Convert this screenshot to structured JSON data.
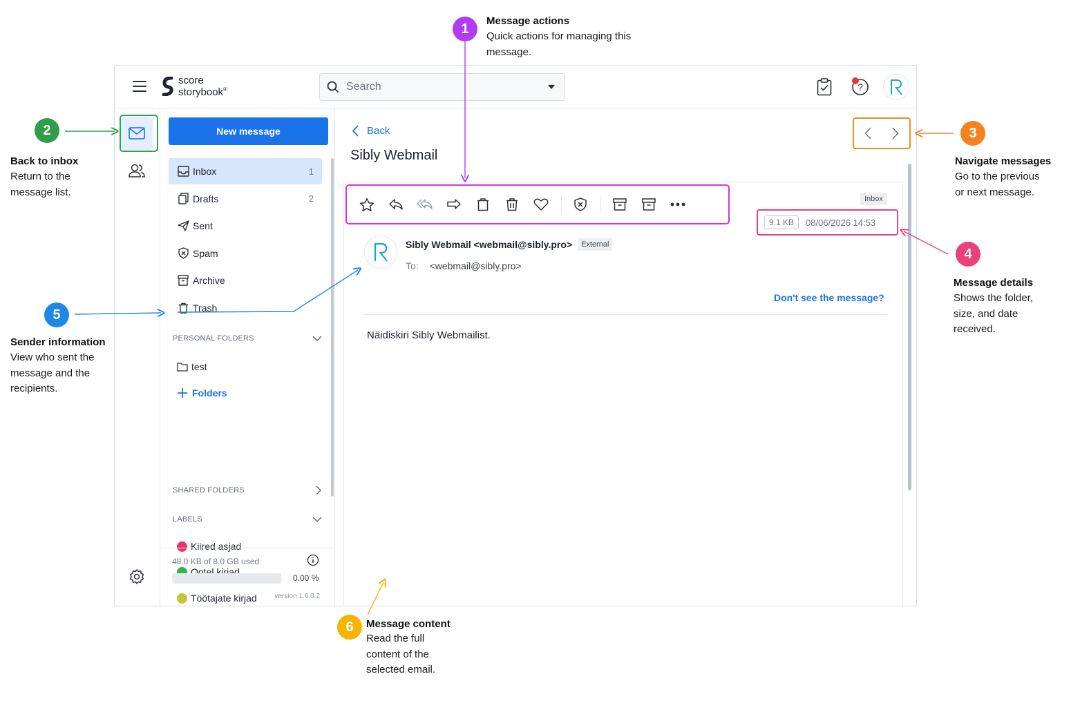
{
  "app": {
    "logo_line1": "score",
    "logo_line2": "storybook",
    "logo_mark": "®"
  },
  "search": {
    "placeholder": "Search"
  },
  "compose": {
    "label": "New message"
  },
  "folders": [
    {
      "name": "Inbox",
      "count": "1",
      "icon": "inbox-icon",
      "active": true
    },
    {
      "name": "Drafts",
      "count": "2",
      "icon": "drafts-icon",
      "active": false
    },
    {
      "name": "Sent",
      "count": "",
      "icon": "sent-icon",
      "active": false
    },
    {
      "name": "Spam",
      "count": "",
      "icon": "spam-icon",
      "active": false
    },
    {
      "name": "Archive",
      "count": "",
      "icon": "archive-icon",
      "active": false
    },
    {
      "name": "Trash",
      "count": "",
      "icon": "trash-icon",
      "active": false
    }
  ],
  "personal_folders": {
    "heading": "PERSONAL FOLDERS",
    "items": [
      "test"
    ],
    "add_label": "Folders"
  },
  "shared_folders": {
    "heading": "SHARED FOLDERS"
  },
  "labels": {
    "heading": "LABELS",
    "items": [
      {
        "name": "Kiired asjad",
        "color": "#e8336d"
      },
      {
        "name": "Ootel kirjad",
        "color": "#2fb550"
      },
      {
        "name": "Töötajate kirjad",
        "color": "#c8c43a"
      }
    ]
  },
  "storage": {
    "used_text": "48.0 KB of 8.0 GB used",
    "percent_text": "0.00 %",
    "percent": 0,
    "version": "version 1.6.0.2"
  },
  "message": {
    "back_label": "Back",
    "subject": "Sibly Webmail",
    "folder_tag": "Inbox",
    "size": "9.1 KB",
    "date": "08/06/2026 14:53",
    "sender": "Sibly Webmail <webmail@sibly.pro>",
    "sender_tag": "External",
    "to_label": "To:",
    "to": "<webmail@sibly.pro>",
    "dont_see": "Don't see the message?",
    "body": "Näidiskiri Sibly Webmailist."
  },
  "annotations": [
    {
      "num": "1",
      "title": "Message actions",
      "desc": [
        "Quick actions for managing this",
        "message."
      ],
      "color": "#b13df0"
    },
    {
      "num": "2",
      "title": "Back to inbox",
      "desc": [
        "Return to the",
        "message list."
      ],
      "color": "#2e9e48"
    },
    {
      "num": "3",
      "title": "Navigate messages",
      "desc": [
        "Go to the previous",
        "or next message."
      ],
      "color": "#f58220"
    },
    {
      "num": "4",
      "title": "Message details",
      "desc": [
        "Shows the folder,",
        "size, and date",
        "received."
      ],
      "color": "#ec407a"
    },
    {
      "num": "5",
      "title": "Sender information",
      "desc": [
        "View who sent the",
        "message and the",
        "recipients."
      ],
      "color": "#1e88e5"
    },
    {
      "num": "6",
      "title": "Message content",
      "desc": [
        "Read the full",
        "content of the",
        "selected email."
      ],
      "color": "#f4b400"
    }
  ],
  "colors": {
    "primary": "#1a73e8",
    "actions_highlight": "#d633d6",
    "details_highlight": "#e0457b",
    "nav_highlight": "#f28c1a"
  }
}
